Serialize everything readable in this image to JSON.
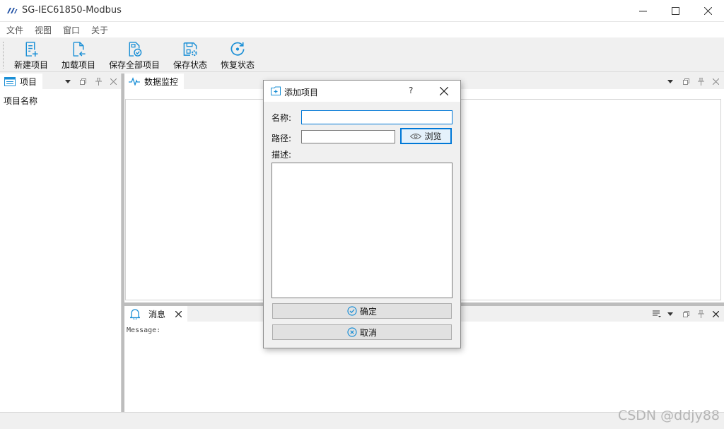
{
  "window": {
    "title": "SG-IEC61850-Modbus",
    "icon": "app-logo-icon",
    "controls": [
      "minimize-icon",
      "maximize-icon",
      "close-icon"
    ]
  },
  "menu": {
    "items": [
      {
        "label": "文件"
      },
      {
        "label": "视图"
      },
      {
        "label": "窗口"
      },
      {
        "label": "关于"
      }
    ]
  },
  "toolbar": {
    "buttons": [
      {
        "label": "新建项目",
        "icon": "new-project-icon"
      },
      {
        "label": "加载项目",
        "icon": "load-project-icon"
      },
      {
        "label": "保存全部项目",
        "icon": "save-all-icon"
      },
      {
        "label": "保存状态",
        "icon": "save-state-icon"
      },
      {
        "label": "恢复状态",
        "icon": "restore-state-icon"
      }
    ],
    "accent": "#1a8fd6"
  },
  "project_pane": {
    "tab_label": "项目",
    "tree_header": "项目名称"
  },
  "monitor_pane": {
    "tab_label": "数据监控"
  },
  "message_pane": {
    "tab_label": "消息",
    "text": "Message:"
  },
  "dialog": {
    "title": "添加项目",
    "help": "?",
    "name_label": "名称:",
    "name_value": "",
    "path_label": "路径:",
    "path_value": "",
    "browse_label": "浏览",
    "desc_label": "描述:",
    "desc_value": "",
    "ok_label": "确定",
    "cancel_label": "取消"
  },
  "watermark": "CSDN @ddjy88"
}
